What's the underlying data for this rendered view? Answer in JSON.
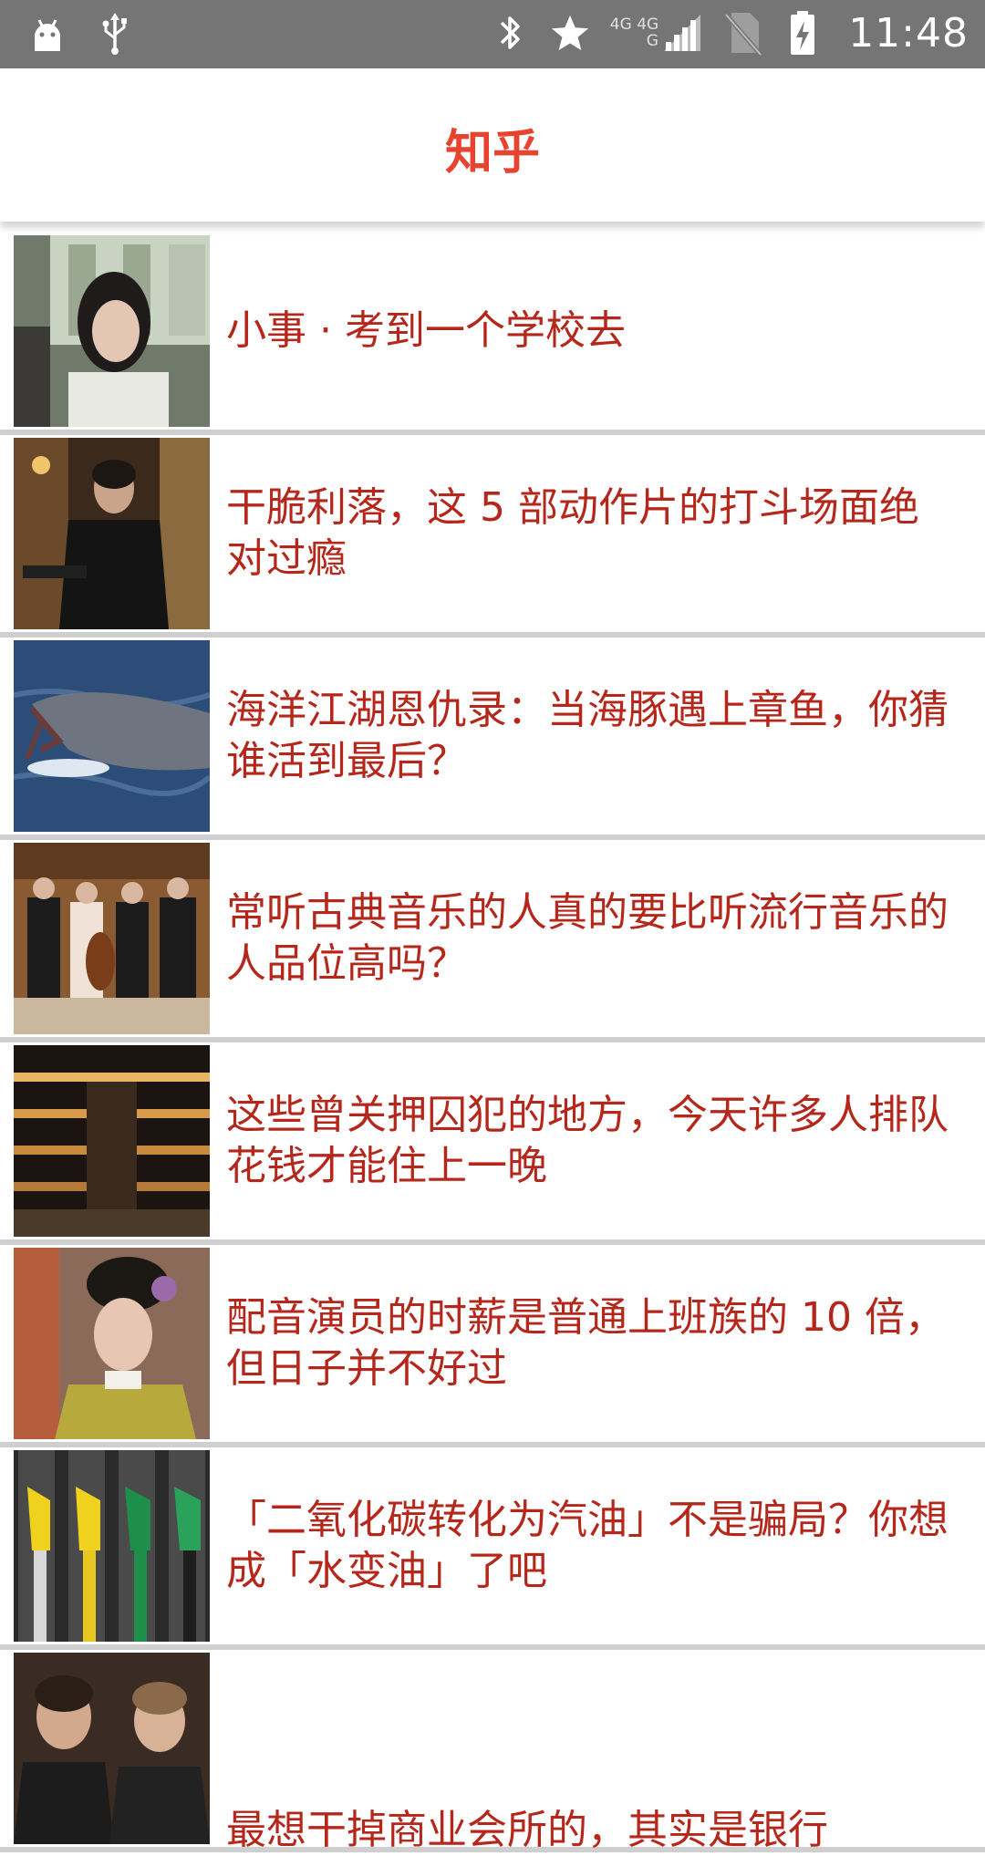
{
  "status_bar": {
    "time": "11:48",
    "network_top": "4G 4G",
    "network_bottom": "G",
    "left_icons": [
      "android-debug-icon",
      "usb-icon"
    ],
    "right_icons": [
      "bluetooth-icon",
      "star-icon",
      "signal-icon",
      "no-sim-icon",
      "battery-charging-icon"
    ]
  },
  "app_bar": {
    "title": "知乎",
    "accent_color": "#e8432f"
  },
  "stories": [
    {
      "title": "小事 · 考到一个学校去",
      "thumb": "girl-on-bus-photo"
    },
    {
      "title": "干脆利落，这 5 部动作片的打斗场面绝对过瘾",
      "thumb": "man-with-gun-photo"
    },
    {
      "title": "海洋江湖恩仇录：当海豚遇上章鱼，你猜谁活到最后？",
      "thumb": "dolphin-octopus-photo"
    },
    {
      "title": "常听古典音乐的人真的要比听流行音乐的人品位高吗？",
      "thumb": "string-quartet-photo"
    },
    {
      "title": "这些曾关押囚犯的地方，今天许多人排队花钱才能住上一晚",
      "thumb": "prison-hotel-atrium-photo"
    },
    {
      "title": "配音演员的时薪是普通上班族的 10 倍，但日子并不好过",
      "thumb": "qing-costume-actress-photo"
    },
    {
      "title": "「二氧化碳转化为汽油」不是骗局？你想成「水变油」了吧",
      "thumb": "fuel-nozzles-photo"
    },
    {
      "title": "最想干掉商业会所的，其实是银行",
      "thumb": "men-in-suits-photo"
    }
  ],
  "colors": {
    "status_bar_bg": "#757575",
    "story_title": "#b5271b",
    "divider": "#cfcfcf"
  }
}
